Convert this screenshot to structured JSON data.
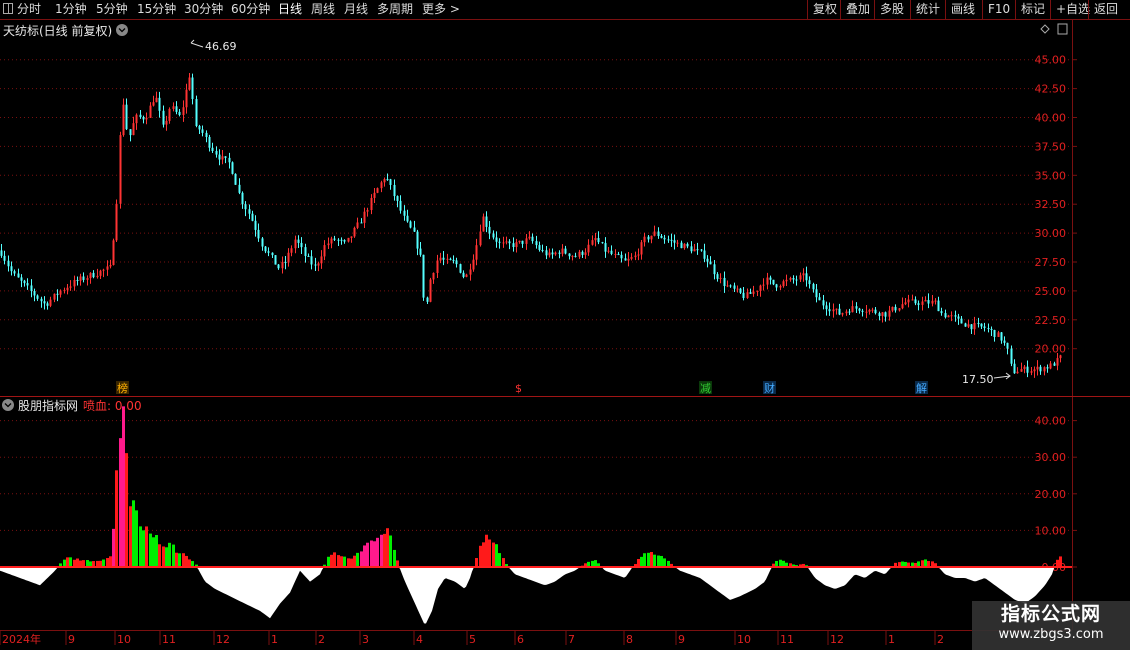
{
  "toolbar": {
    "left": [
      {
        "label": "分时"
      },
      {
        "label": "1分钟"
      },
      {
        "label": "5分钟"
      },
      {
        "label": "15分钟"
      },
      {
        "label": "30分钟"
      },
      {
        "label": "60分钟"
      },
      {
        "label": "日线"
      },
      {
        "label": "周线"
      },
      {
        "label": "月线"
      },
      {
        "label": "多周期"
      },
      {
        "label": "更多 >"
      }
    ],
    "right": [
      {
        "label": "复权"
      },
      {
        "label": "叠加"
      },
      {
        "label": "多股"
      },
      {
        "label": "统计"
      },
      {
        "label": "画线"
      },
      {
        "label": "F10"
      },
      {
        "label": "标记"
      },
      {
        "label": "+自选"
      },
      {
        "label": "返回"
      }
    ]
  },
  "main_panel": {
    "title": "天纺标(日线 前复权)",
    "high_label": "46.69",
    "low_label": "17.50",
    "y_ticks": [
      "45.00",
      "42.50",
      "40.00",
      "37.50",
      "35.00",
      "32.50",
      "30.00",
      "27.50",
      "25.00",
      "22.50",
      "20.00"
    ],
    "event_markers": [
      {
        "text": "榜",
        "color": "#ffb000"
      },
      {
        "text": "$",
        "color": "#ff3333"
      },
      {
        "text": "减",
        "color": "#33cc33"
      },
      {
        "text": "财",
        "color": "#44aaff"
      },
      {
        "text": "解",
        "color": "#44aaff"
      }
    ]
  },
  "indicator_panel": {
    "title": "股朋指标网",
    "value_label": "喷血: 0.00",
    "y_ticks": [
      "40.00",
      "30.00",
      "20.00",
      "10.00",
      "0.00"
    ]
  },
  "x_axis": {
    "labels": [
      "2024年",
      "9",
      "10",
      "11",
      "12",
      "1",
      "2",
      "3",
      "4",
      "5",
      "6",
      "7",
      "8",
      "9",
      "10",
      "11",
      "12",
      "1",
      "2"
    ]
  },
  "watermark": {
    "title": "指标公式网",
    "url": "www.zbgs3.com"
  },
  "colors": {
    "up": "#ff3333",
    "down": "#54ffff",
    "grid": "#7a1010",
    "bar_green": "#00ee00",
    "bar_red": "#ff1a1a",
    "bar_magenta": "#ff1a8c",
    "negative_area": "#ffffff"
  },
  "chart_data": {
    "type": "candlestick",
    "title": "天纺标(日线 前复权)",
    "price_ylim": [
      17,
      48
    ],
    "highest": 46.69,
    "lowest": 17.5,
    "price_path": [
      [
        0,
        28.5
      ],
      [
        12,
        26.5
      ],
      [
        30,
        25
      ],
      [
        45,
        23.8
      ],
      [
        60,
        25
      ],
      [
        75,
        25.8
      ],
      [
        95,
        26.5
      ],
      [
        110,
        27
      ],
      [
        116,
        32
      ],
      [
        122,
        42
      ],
      [
        128,
        38
      ],
      [
        135,
        40
      ],
      [
        145,
        40
      ],
      [
        155,
        42
      ],
      [
        163,
        39
      ],
      [
        170,
        41
      ],
      [
        180,
        40
      ],
      [
        190,
        44
      ],
      [
        195,
        39
      ],
      [
        200,
        39
      ],
      [
        210,
        37.5
      ],
      [
        220,
        36.5
      ],
      [
        230,
        36
      ],
      [
        240,
        33
      ],
      [
        250,
        31.5
      ],
      [
        262,
        29
      ],
      [
        270,
        28
      ],
      [
        278,
        27
      ],
      [
        285,
        27.5
      ],
      [
        295,
        29.5
      ],
      [
        305,
        28
      ],
      [
        315,
        27
      ],
      [
        325,
        29
      ],
      [
        335,
        29.5
      ],
      [
        345,
        29
      ],
      [
        360,
        31
      ],
      [
        375,
        33.5
      ],
      [
        385,
        35
      ],
      [
        395,
        33
      ],
      [
        405,
        31
      ],
      [
        413,
        30
      ],
      [
        420,
        28
      ],
      [
        425,
        23
      ],
      [
        430,
        26
      ],
      [
        438,
        28
      ],
      [
        445,
        27.5
      ],
      [
        455,
        27.5
      ],
      [
        465,
        26
      ],
      [
        475,
        28.5
      ],
      [
        482,
        31.5
      ],
      [
        490,
        30
      ],
      [
        500,
        29
      ],
      [
        515,
        29
      ],
      [
        530,
        29.5
      ],
      [
        540,
        28.5
      ],
      [
        550,
        28
      ],
      [
        560,
        28.5
      ],
      [
        575,
        28
      ],
      [
        585,
        28.5
      ],
      [
        595,
        29.5
      ],
      [
        605,
        28.5
      ],
      [
        615,
        28
      ],
      [
        625,
        27.5
      ],
      [
        635,
        28
      ],
      [
        645,
        29.5
      ],
      [
        655,
        30
      ],
      [
        665,
        29.5
      ],
      [
        680,
        29
      ],
      [
        695,
        28.5
      ],
      [
        705,
        28
      ],
      [
        715,
        26.5
      ],
      [
        725,
        25.5
      ],
      [
        735,
        25
      ],
      [
        745,
        24.5
      ],
      [
        755,
        25
      ],
      [
        765,
        26
      ],
      [
        775,
        25.5
      ],
      [
        785,
        25.8
      ],
      [
        795,
        26
      ],
      [
        805,
        26.3
      ],
      [
        812,
        25
      ],
      [
        820,
        24
      ],
      [
        830,
        23.5
      ],
      [
        840,
        23
      ],
      [
        850,
        23.5
      ],
      [
        860,
        23.5
      ],
      [
        875,
        23.2
      ],
      [
        885,
        23
      ],
      [
        895,
        23.5
      ],
      [
        905,
        24
      ],
      [
        915,
        24
      ],
      [
        925,
        24
      ],
      [
        935,
        24
      ],
      [
        942,
        23
      ],
      [
        950,
        22.8
      ],
      [
        960,
        22.3
      ],
      [
        970,
        22
      ],
      [
        985,
        21.8
      ],
      [
        1000,
        21
      ],
      [
        1007,
        20
      ],
      [
        1012,
        18
      ],
      [
        1020,
        18.2
      ],
      [
        1035,
        18.2
      ],
      [
        1050,
        18.5
      ],
      [
        1058,
        19
      ],
      [
        1063,
        19.5
      ]
    ],
    "indicator_ylim": [
      -17,
      44
    ],
    "indicator_path": [
      [
        0,
        -1
      ],
      [
        20,
        -3
      ],
      [
        40,
        -5
      ],
      [
        55,
        -1
      ],
      [
        65,
        2.5
      ],
      [
        80,
        2
      ],
      [
        100,
        1.5
      ],
      [
        112,
        3
      ],
      [
        118,
        38
      ],
      [
        124,
        40
      ],
      [
        128,
        20
      ],
      [
        134,
        16
      ],
      [
        140,
        12
      ],
      [
        148,
        9
      ],
      [
        155,
        8
      ],
      [
        162,
        6
      ],
      [
        170,
        6
      ],
      [
        178,
        4
      ],
      [
        185,
        3
      ],
      [
        195,
        1
      ],
      [
        205,
        -4
      ],
      [
        215,
        -6
      ],
      [
        230,
        -8
      ],
      [
        245,
        -10
      ],
      [
        260,
        -12
      ],
      [
        270,
        -14
      ],
      [
        280,
        -10
      ],
      [
        290,
        -7
      ],
      [
        300,
        -1
      ],
      [
        310,
        -4
      ],
      [
        320,
        -2
      ],
      [
        330,
        4
      ],
      [
        340,
        3
      ],
      [
        350,
        2
      ],
      [
        360,
        4
      ],
      [
        370,
        7
      ],
      [
        380,
        10
      ],
      [
        390,
        10
      ],
      [
        395,
        3
      ],
      [
        405,
        -4
      ],
      [
        415,
        -10
      ],
      [
        425,
        -16
      ],
      [
        432,
        -12
      ],
      [
        438,
        -6
      ],
      [
        445,
        -3
      ],
      [
        455,
        -4
      ],
      [
        465,
        -6
      ],
      [
        470,
        -3
      ],
      [
        478,
        4
      ],
      [
        485,
        9
      ],
      [
        495,
        7
      ],
      [
        505,
        1
      ],
      [
        515,
        -2
      ],
      [
        525,
        -3
      ],
      [
        535,
        -4
      ],
      [
        545,
        -5
      ],
      [
        555,
        -4
      ],
      [
        565,
        -2
      ],
      [
        575,
        -1
      ],
      [
        585,
        1
      ],
      [
        595,
        2
      ],
      [
        605,
        -1
      ],
      [
        615,
        -2
      ],
      [
        625,
        -3
      ],
      [
        640,
        3
      ],
      [
        650,
        4
      ],
      [
        660,
        3
      ],
      [
        670,
        1
      ],
      [
        680,
        -1
      ],
      [
        690,
        -2
      ],
      [
        700,
        -3
      ],
      [
        710,
        -5
      ],
      [
        720,
        -7
      ],
      [
        730,
        -9
      ],
      [
        740,
        -8
      ],
      [
        755,
        -6
      ],
      [
        765,
        -4
      ],
      [
        775,
        2
      ],
      [
        785,
        1.5
      ],
      [
        795,
        0.5
      ],
      [
        805,
        1
      ],
      [
        815,
        -3
      ],
      [
        825,
        -5
      ],
      [
        835,
        -6
      ],
      [
        845,
        -5
      ],
      [
        855,
        -2
      ],
      [
        865,
        -3
      ],
      [
        875,
        -1
      ],
      [
        885,
        -2
      ],
      [
        895,
        1
      ],
      [
        905,
        1.5
      ],
      [
        915,
        1
      ],
      [
        925,
        2
      ],
      [
        935,
        1
      ],
      [
        945,
        -2
      ],
      [
        955,
        -3
      ],
      [
        965,
        -3
      ],
      [
        975,
        -4
      ],
      [
        985,
        -3
      ],
      [
        995,
        -5
      ],
      [
        1005,
        -7
      ],
      [
        1015,
        -9
      ],
      [
        1025,
        -10
      ],
      [
        1035,
        -8
      ],
      [
        1045,
        -5
      ],
      [
        1052,
        -2
      ],
      [
        1058,
        3
      ],
      [
        1063,
        3
      ]
    ]
  }
}
